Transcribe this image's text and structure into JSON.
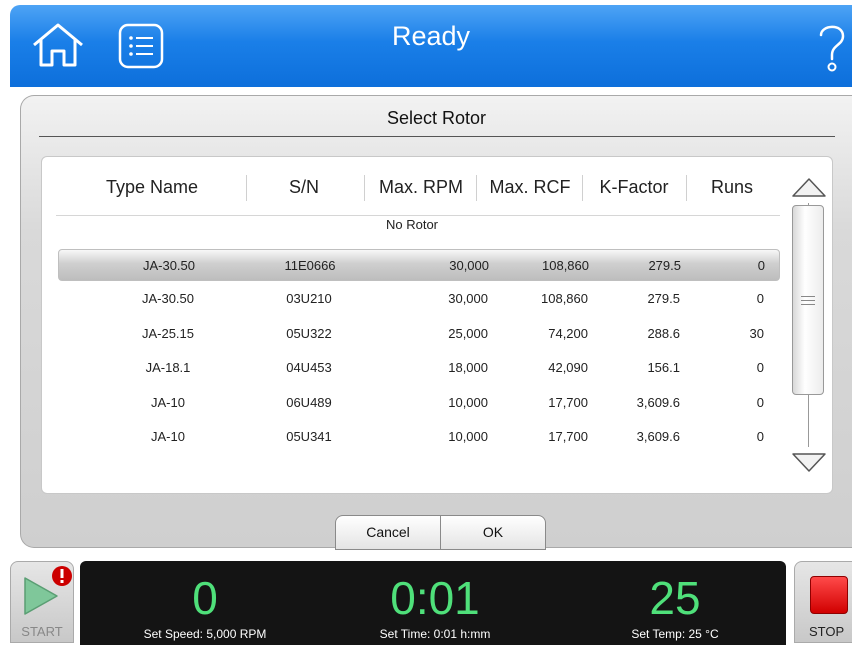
{
  "header": {
    "title": "Ready",
    "icons": {
      "home": "home-icon",
      "list": "list-icon",
      "help": "help-icon"
    }
  },
  "dialog": {
    "title": "Select Rotor",
    "columns": [
      "Type Name",
      "S/N",
      "Max. RPM",
      "Max. RCF",
      "K-Factor",
      "Runs"
    ],
    "no_rotor": "No Rotor",
    "rows": [
      {
        "type_name": "JA-30.50",
        "sn": "11E0666",
        "max_rpm": "30,000",
        "max_rcf": "108,860",
        "k_factor": "279.5",
        "runs": "0",
        "selected": true
      },
      {
        "type_name": "JA-30.50",
        "sn": "03U210",
        "max_rpm": "30,000",
        "max_rcf": "108,860",
        "k_factor": "279.5",
        "runs": "0",
        "selected": false
      },
      {
        "type_name": "JA-25.15",
        "sn": "05U322",
        "max_rpm": "25,000",
        "max_rcf": "74,200",
        "k_factor": "288.6",
        "runs": "30",
        "selected": false
      },
      {
        "type_name": "JA-18.1",
        "sn": "04U453",
        "max_rpm": "18,000",
        "max_rcf": "42,090",
        "k_factor": "156.1",
        "runs": "0",
        "selected": false
      },
      {
        "type_name": "JA-10",
        "sn": "06U489",
        "max_rpm": "10,000",
        "max_rcf": "17,700",
        "k_factor": "3,609.6",
        "runs": "0",
        "selected": false
      },
      {
        "type_name": "JA-10",
        "sn": "05U341",
        "max_rpm": "10,000",
        "max_rcf": "17,700",
        "k_factor": "3,609.6",
        "runs": "0",
        "selected": false
      }
    ],
    "cancel_label": "Cancel",
    "ok_label": "OK"
  },
  "controls": {
    "start_label": "START",
    "stop_label": "STOP",
    "alert_icon": "alert-icon"
  },
  "status": {
    "speed_value": "0",
    "speed_label": "Set Speed: 5,000 RPM",
    "time_value": "0:01",
    "time_label": "Set Time: 0:01 h:mm",
    "temp_value": "25",
    "temp_label": "Set Temp: 25 °C"
  },
  "colors": {
    "header_blue": "#1a7fe8",
    "status_green": "#4fe07a",
    "stop_red": "#d10000",
    "alert_red": "#cc0000"
  }
}
